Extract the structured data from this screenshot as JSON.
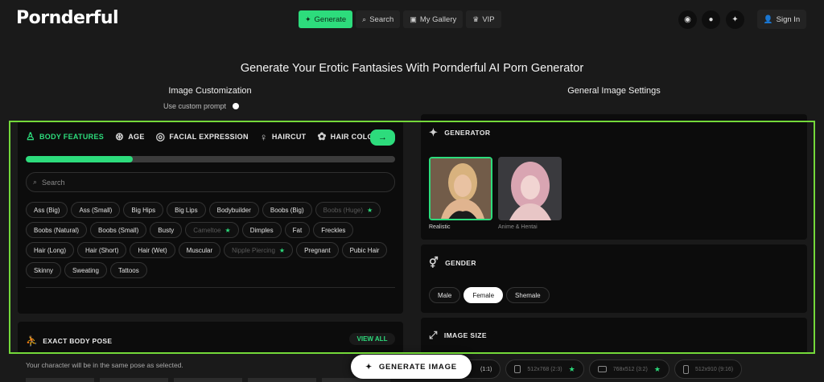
{
  "brand": {
    "logo_text": "Pornderful",
    "accent": "#2ddc7c"
  },
  "nav": [
    {
      "label": "Generate",
      "icon": "magic-wand-icon",
      "active": true
    },
    {
      "label": "Search",
      "icon": "search-icon",
      "active": false
    },
    {
      "label": "My Gallery",
      "icon": "gallery-icon",
      "active": false
    },
    {
      "label": "VIP",
      "icon": "crown-icon",
      "active": false
    }
  ],
  "social": [
    "discord-icon",
    "reddit-icon",
    "twitter-icon"
  ],
  "signin_label": "Sign In",
  "headline": "Generate Your Erotic Fantasies With Pornderful AI Porn Generator",
  "left": {
    "heading": "Image Customization",
    "custom_prompt_label": "Use custom prompt",
    "tabs": [
      {
        "label": "BODY FEATURES",
        "icon": "body-icon",
        "active": true
      },
      {
        "label": "AGE",
        "icon": "age-icon",
        "active": false
      },
      {
        "label": "FACIAL EXPRESSION",
        "icon": "face-icon",
        "active": false
      },
      {
        "label": "HAIRCUT",
        "icon": "haircut-icon",
        "active": false
      },
      {
        "label": "HAIR COLOR",
        "icon": "hair-color-icon",
        "active": false
      }
    ],
    "progress": 0.29,
    "search_placeholder": "Search",
    "chips": [
      {
        "label": "Ass (Big)",
        "vip": false
      },
      {
        "label": "Ass (Small)",
        "vip": false
      },
      {
        "label": "Big Hips",
        "vip": false
      },
      {
        "label": "Big Lips",
        "vip": false
      },
      {
        "label": "Bodybuilder",
        "vip": false
      },
      {
        "label": "Boobs (Big)",
        "vip": false
      },
      {
        "label": "Boobs (Huge)",
        "vip": true
      },
      {
        "label": "Boobs (Natural)",
        "vip": false
      },
      {
        "label": "Boobs (Small)",
        "vip": false
      },
      {
        "label": "Busty",
        "vip": false
      },
      {
        "label": "Cameltoe",
        "vip": true
      },
      {
        "label": "Dimples",
        "vip": false
      },
      {
        "label": "Fat",
        "vip": false
      },
      {
        "label": "Freckles",
        "vip": false
      },
      {
        "label": "Hair (Long)",
        "vip": false
      },
      {
        "label": "Hair (Short)",
        "vip": false
      },
      {
        "label": "Hair (Wet)",
        "vip": false
      },
      {
        "label": "Muscular",
        "vip": false
      },
      {
        "label": "Nipple Piercing",
        "vip": true
      },
      {
        "label": "Pregnant",
        "vip": false
      },
      {
        "label": "Pubic Hair",
        "vip": false
      },
      {
        "label": "Skinny",
        "vip": false
      },
      {
        "label": "Sweating",
        "vip": false
      },
      {
        "label": "Tattoos",
        "vip": false
      }
    ],
    "pose_title": "EXACT BODY POSE",
    "view_all_label": "VIEW ALL",
    "pose_subtitle": "Your character will be in the same pose as selected."
  },
  "right": {
    "heading": "General Image Settings",
    "generator_title": "GENERATOR",
    "generators": [
      {
        "label": "Realistic",
        "selected": true
      },
      {
        "label": "Anime & Hentai",
        "selected": false
      }
    ],
    "gender_title": "GENDER",
    "genders": [
      {
        "label": "Male",
        "selected": false
      },
      {
        "label": "Female",
        "selected": true
      },
      {
        "label": "Shemale",
        "selected": false
      }
    ],
    "size_title": "IMAGE SIZE",
    "sizes": [
      {
        "label": "(1:1)"
      },
      {
        "label": "512x768 (2:3)"
      },
      {
        "label": "768x512 (3:2)"
      },
      {
        "label": "512x910 (9:16)"
      }
    ]
  },
  "generate_button_label": "GENERATE IMAGE"
}
